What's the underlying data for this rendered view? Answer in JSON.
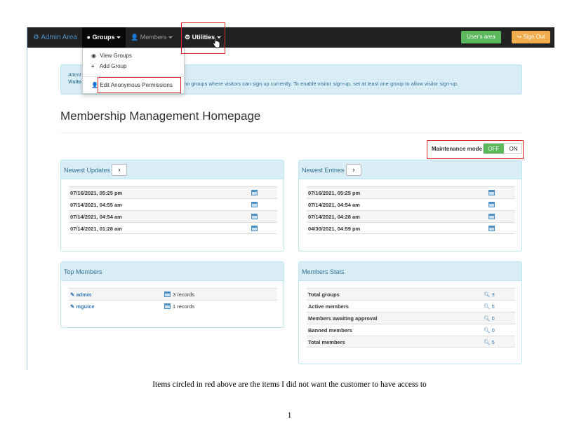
{
  "navbar": {
    "brand": "Admin Area",
    "groups": "Groups",
    "members": "Members",
    "utilities": "Utilities",
    "users_area": "User's area",
    "sign_out": "Sign Out"
  },
  "dropdown": {
    "items": [
      "View Groups",
      "Add Group",
      "Edit Anonymous Permissions"
    ]
  },
  "alert": {
    "title": "Attent",
    "strong": "Visito",
    "text": "no groups where visitors can sign up currently. To enable visitor sign-up, set at least one group to allow visitor sign-up."
  },
  "page_title": "Membership Management Homepage",
  "maintenance": {
    "label": "Maintenance mode",
    "off": "OFF",
    "on": "ON"
  },
  "newest_updates": {
    "title": "Newest Updates",
    "rows": [
      "07/16/2021, 05:25 pm",
      "07/14/2021, 04:55 am",
      "07/14/2021, 04:54 am",
      "07/14/2021, 01:28 am"
    ]
  },
  "newest_entries": {
    "title": "Newest Entries",
    "rows": [
      "07/16/2021, 05:25 pm",
      "07/14/2021, 04:54 am",
      "07/14/2021, 04:28 am",
      "04/30/2021, 04:59 pm"
    ]
  },
  "top_members": {
    "title": "Top Members",
    "rows": [
      {
        "name": "admin",
        "records": "3 records"
      },
      {
        "name": "mguice",
        "records": "1 records"
      }
    ]
  },
  "members_stats": {
    "title": "Members Stats",
    "rows": [
      {
        "label": "Total groups",
        "value": "3"
      },
      {
        "label": "Active members",
        "value": "5"
      },
      {
        "label": "Members awaiting approval",
        "value": "0"
      },
      {
        "label": "Banned members",
        "value": "0"
      },
      {
        "label": "Total members",
        "value": "5"
      }
    ]
  },
  "caption": "Items circled in red above are the items I did not want the customer to have access to",
  "page_number": "1",
  "colors": {
    "navbar": "#222222",
    "accent": "#31708f",
    "panel_head": "#d9edf7",
    "success": "#5cb85c",
    "warning": "#f0ad4e",
    "annotation": "#d9262b"
  }
}
